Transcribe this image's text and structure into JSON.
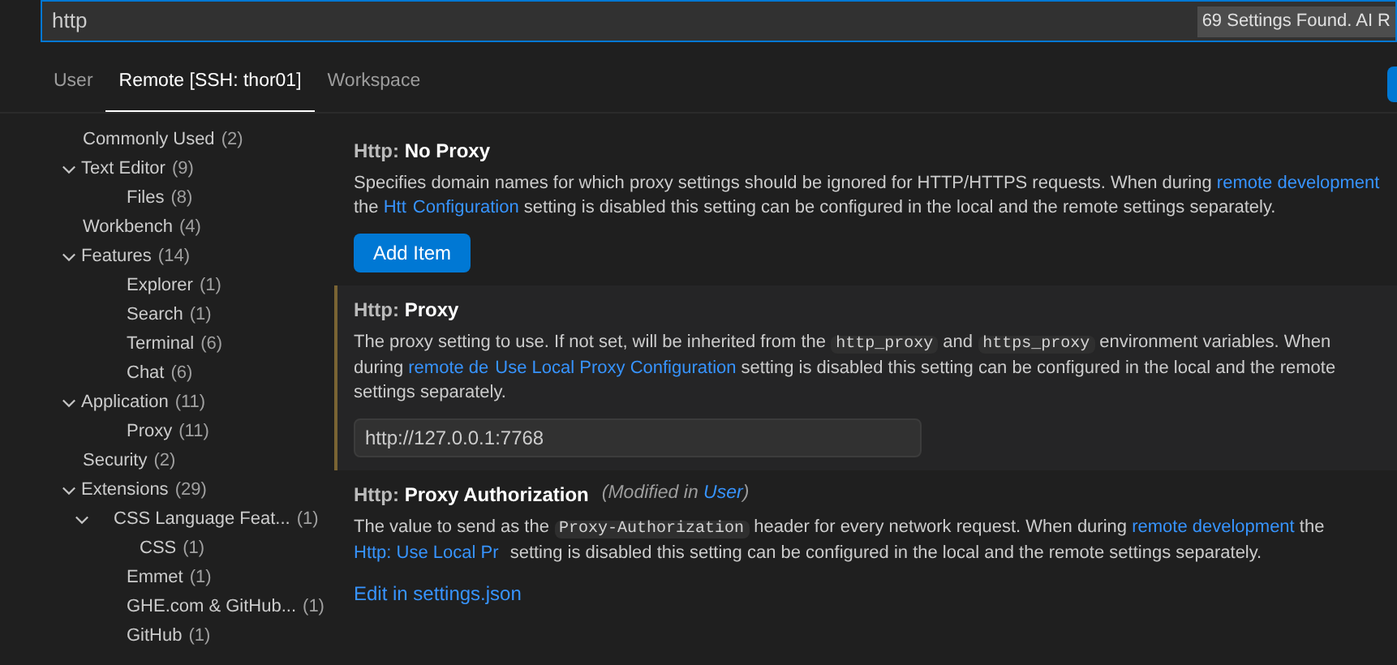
{
  "search": {
    "value": "http",
    "result_count": "69 Settings Found. AI R"
  },
  "tabs": [
    {
      "label": "User",
      "selected": false
    },
    {
      "label": "Remote [SSH: thor01]",
      "selected": true
    },
    {
      "label": "Workspace",
      "selected": false
    }
  ],
  "toc": [
    {
      "label": "Commonly Used",
      "count": "(2)"
    },
    {
      "label": "Text Editor",
      "count": "(9)",
      "expanded": true,
      "children": [
        {
          "label": "Files",
          "count": "(8)"
        }
      ]
    },
    {
      "label": "Workbench",
      "count": "(4)"
    },
    {
      "label": "Features",
      "count": "(14)",
      "expanded": true,
      "children": [
        {
          "label": "Explorer",
          "count": "(1)"
        },
        {
          "label": "Search",
          "count": "(1)"
        },
        {
          "label": "Terminal",
          "count": "(6)"
        },
        {
          "label": "Chat",
          "count": "(6)"
        }
      ]
    },
    {
      "label": "Application",
      "count": "(11)",
      "expanded": true,
      "children": [
        {
          "label": "Proxy",
          "count": "(11)"
        }
      ]
    },
    {
      "label": "Security",
      "count": "(2)"
    },
    {
      "label": "Extensions",
      "count": "(29)",
      "expanded": true,
      "children": [
        {
          "label": "CSS Language Feat...",
          "count": "(1)",
          "expanded": true,
          "children": [
            {
              "label": "CSS",
              "count": "(1)"
            }
          ]
        },
        {
          "label": "Emmet",
          "count": "(1)"
        },
        {
          "label": "GHE.com & GitHub...",
          "count": "(1)"
        },
        {
          "label": "GitHub",
          "count": "(1)"
        }
      ]
    }
  ],
  "settings": [
    {
      "category": "Http: ",
      "name": "No Proxy",
      "focused": false,
      "description": [
        {
          "kind": "text",
          "text": "Specifies domain names for which proxy settings should be ignored for HTTP/HTTPS requests. When during "
        },
        {
          "kind": "link",
          "text": "remote development"
        },
        {
          "kind": "text",
          "text": " the "
        },
        {
          "kind": "link",
          "text": "Htt"
        },
        {
          "kind": "break"
        },
        {
          "kind": "link",
          "text": "Configuration"
        },
        {
          "kind": "text",
          "text": " setting is disabled this setting can be configured in the local and the remote settings separately."
        }
      ],
      "control": {
        "kind": "button",
        "label": "Add Item"
      }
    },
    {
      "category": "Http: ",
      "name": "Proxy",
      "focused": true,
      "description": [
        {
          "kind": "text",
          "text": "The proxy setting to use. If not set, will be inherited from the "
        },
        {
          "kind": "code",
          "text": "http_proxy"
        },
        {
          "kind": "text",
          "text": " and "
        },
        {
          "kind": "code",
          "text": "https_proxy"
        },
        {
          "kind": "text",
          "text": " environment variables. When during "
        },
        {
          "kind": "link",
          "text": "remote de"
        },
        {
          "kind": "break"
        },
        {
          "kind": "link",
          "text": "Use Local Proxy Configuration"
        },
        {
          "kind": "text",
          "text": " setting is disabled this setting can be configured in the local and the remote settings separately."
        }
      ],
      "control": {
        "kind": "input",
        "value": "http://127.0.0.1:7768"
      }
    },
    {
      "category": "Http: ",
      "name": "Proxy Authorization",
      "focused": false,
      "modified": {
        "prefix": "(Modified in ",
        "link": "User",
        "suffix": ")"
      },
      "description": [
        {
          "kind": "text",
          "text": "The value to send as the "
        },
        {
          "kind": "code",
          "text": "Proxy-Authorization"
        },
        {
          "kind": "text",
          "text": " header for every network request. When during "
        },
        {
          "kind": "link",
          "text": "remote development"
        },
        {
          "kind": "text",
          "text": " the "
        },
        {
          "kind": "link",
          "text": "Http: Use Local Pr"
        },
        {
          "kind": "break"
        },
        {
          "kind": "text",
          "text": " setting is disabled this setting can be configured in the local and the remote settings separately."
        }
      ],
      "control": {
        "kind": "link",
        "label": "Edit in settings.json"
      }
    }
  ]
}
